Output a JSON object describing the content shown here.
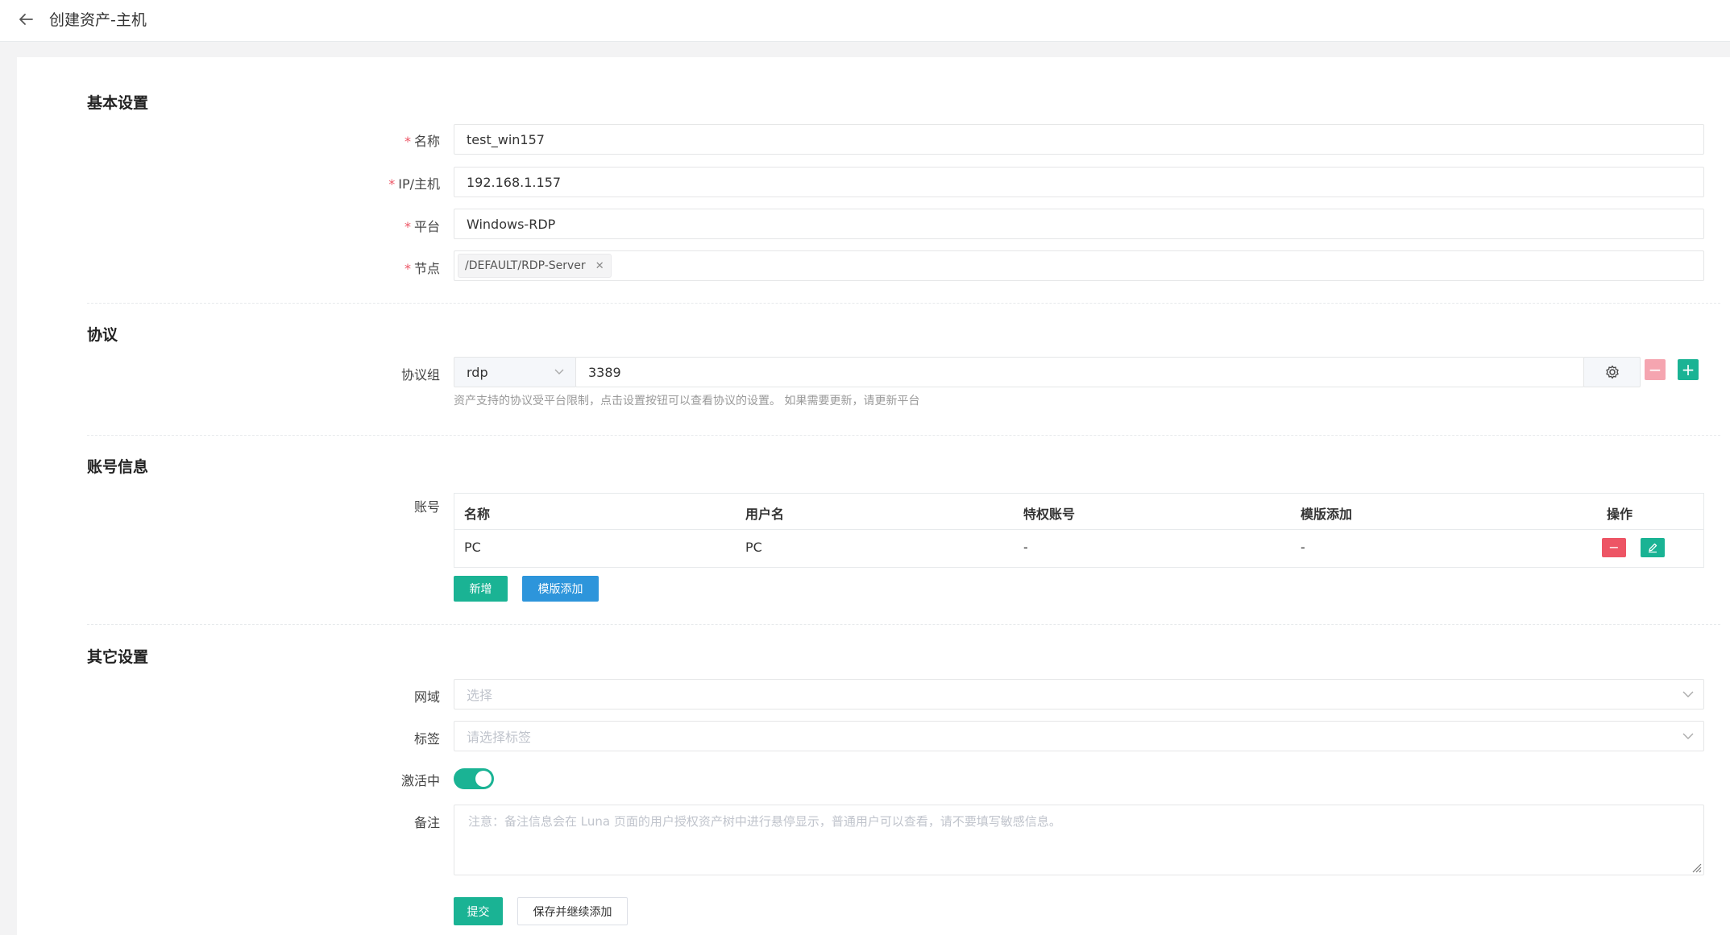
{
  "header": {
    "title": "创建资产-主机"
  },
  "sections": {
    "basic": "基本设置",
    "protocol": "协议",
    "account": "账号信息",
    "other": "其它设置"
  },
  "basic": {
    "name_label": "名称",
    "name_value": "test_win157",
    "ip_label": "IP/主机",
    "ip_value": "192.168.1.157",
    "platform_label": "平台",
    "platform_value": "Windows-RDP",
    "node_label": "节点",
    "node_tag": "/DEFAULT/RDP-Server",
    "required_mark": "*"
  },
  "protocol": {
    "label": "协议组",
    "selected": "rdp",
    "port": "3389",
    "hint": "资产支持的协议受平台限制，点击设置按钮可以查看协议的设置。 如果需要更新，请更新平台",
    "remove_symbol": "−",
    "add_symbol": "+"
  },
  "account": {
    "label": "账号",
    "columns": [
      "名称",
      "用户名",
      "特权账号",
      "模版添加",
      "操作"
    ],
    "rows": [
      {
        "name": "PC",
        "username": "PC",
        "privileged": "-",
        "template": "-"
      }
    ],
    "add_button": "新增",
    "template_button": "模版添加"
  },
  "other": {
    "domain_label": "网域",
    "domain_placeholder": "选择",
    "tags_label": "标签",
    "tags_placeholder": "请选择标签",
    "active_label": "激活中",
    "active": true,
    "comment_label": "备注",
    "comment_placeholder": "注意：备注信息会在 Luna 页面的用户授权资产树中进行悬停显示，普通用户可以查看，请不要填写敏感信息。"
  },
  "actions": {
    "submit": "提交",
    "save_continue": "保存并继续添加"
  },
  "colors": {
    "primary": "#1ab394",
    "danger": "#ed5565",
    "danger_light": "#f5a5b0",
    "info": "#2d95db"
  },
  "icons": [
    "back-arrow-icon",
    "close-icon",
    "chevron-down-icon",
    "gear-icon",
    "minus-icon",
    "plus-icon",
    "edit-icon",
    "resize-handle-icon"
  ]
}
